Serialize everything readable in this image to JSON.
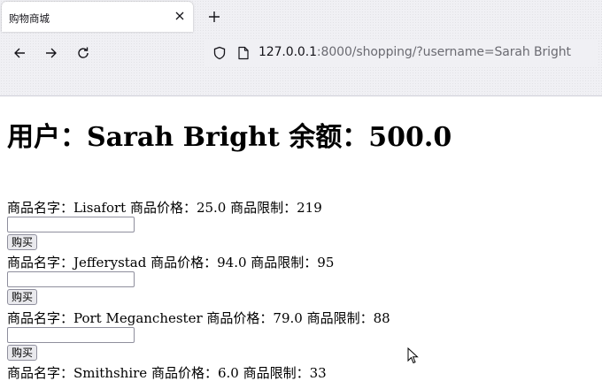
{
  "browser": {
    "tab_title": "购物商城",
    "url_host": "127.0.0.1",
    "url_rest": ":8000/shopping/?username=Sarah Bright",
    "icons": [
      "close-icon",
      "plus-icon",
      "arrow-left-icon",
      "arrow-right-icon",
      "reload-icon",
      "shield-icon",
      "page-icon"
    ]
  },
  "header": {
    "text": "用户：Sarah Bright 余额：500.0"
  },
  "products": [
    {
      "line": "商品名字：Lisafort 商品价格：25.0 商品限制：219",
      "button": "购买"
    },
    {
      "line": "商品名字：Jefferystad 商品价格：94.0 商品限制：95",
      "button": "购买"
    },
    {
      "line": "商品名字：Port Meganchester 商品价格：79.0 商品限制：88",
      "button": "购买"
    },
    {
      "line": "商品名字：Smithshire 商品价格：6.0 商品限制：33"
    }
  ]
}
